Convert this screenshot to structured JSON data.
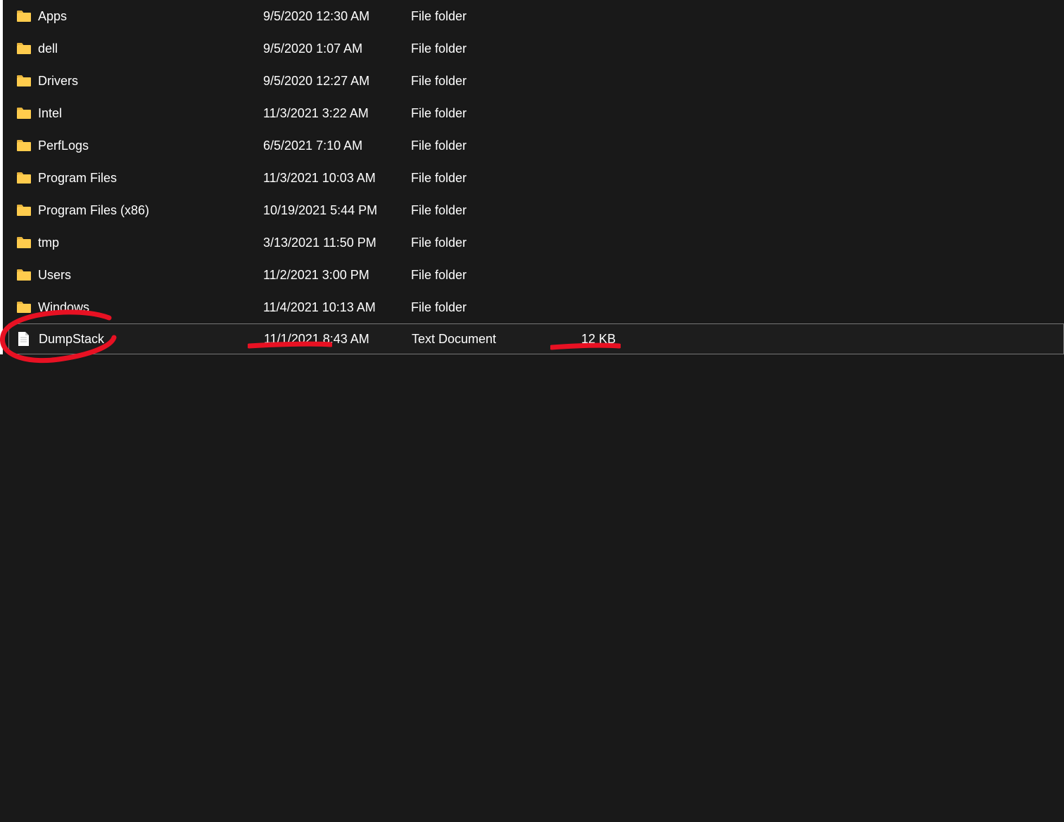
{
  "items": [
    {
      "name": "Apps",
      "date": "9/5/2020 12:30 AM",
      "type": "File folder",
      "size": "",
      "kind": "folder",
      "selected": false
    },
    {
      "name": "dell",
      "date": "9/5/2020 1:07 AM",
      "type": "File folder",
      "size": "",
      "kind": "folder",
      "selected": false
    },
    {
      "name": "Drivers",
      "date": "9/5/2020 12:27 AM",
      "type": "File folder",
      "size": "",
      "kind": "folder",
      "selected": false
    },
    {
      "name": "Intel",
      "date": "11/3/2021 3:22 AM",
      "type": "File folder",
      "size": "",
      "kind": "folder",
      "selected": false
    },
    {
      "name": "PerfLogs",
      "date": "6/5/2021 7:10 AM",
      "type": "File folder",
      "size": "",
      "kind": "folder",
      "selected": false
    },
    {
      "name": "Program Files",
      "date": "11/3/2021 10:03 AM",
      "type": "File folder",
      "size": "",
      "kind": "folder",
      "selected": false
    },
    {
      "name": "Program Files (x86)",
      "date": "10/19/2021 5:44 PM",
      "type": "File folder",
      "size": "",
      "kind": "folder",
      "selected": false
    },
    {
      "name": "tmp",
      "date": "3/13/2021 11:50 PM",
      "type": "File folder",
      "size": "",
      "kind": "folder",
      "selected": false
    },
    {
      "name": "Users",
      "date": "11/2/2021 3:00 PM",
      "type": "File folder",
      "size": "",
      "kind": "folder",
      "selected": false
    },
    {
      "name": "Windows",
      "date": "11/4/2021 10:13 AM",
      "type": "File folder",
      "size": "",
      "kind": "folder",
      "selected": false
    },
    {
      "name": "DumpStack",
      "date": "11/1/2021 8:43 AM",
      "type": "Text Document",
      "size": "12 KB",
      "kind": "file",
      "selected": true
    }
  ],
  "colors": {
    "folder": "#ffcc4d",
    "folderTab": "#e6b33d",
    "file": "#ffffff",
    "annotation": "#e81123"
  }
}
